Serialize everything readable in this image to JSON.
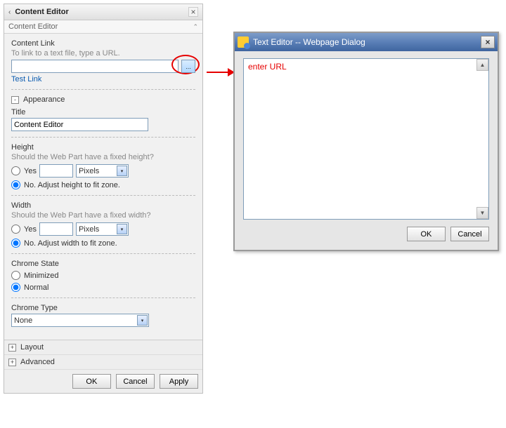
{
  "panel": {
    "header_title": "Content Editor",
    "sub_title": "Content Editor",
    "content_link": {
      "label": "Content Link",
      "hint": "To link to a text file, type a URL.",
      "value": "",
      "test_link_text": "Test Link"
    },
    "appearance": {
      "section_label": "Appearance",
      "title_label": "Title",
      "title_value": "Content Editor",
      "height_label": "Height",
      "height_hint": "Should the Web Part have a fixed height?",
      "height_yes": "Yes",
      "height_value": "",
      "height_unit": "Pixels",
      "height_no": "No. Adjust height to fit zone.",
      "width_label": "Width",
      "width_hint": "Should the Web Part have a fixed width?",
      "width_yes": "Yes",
      "width_value": "",
      "width_unit": "Pixels",
      "width_no": "No. Adjust width to fit zone.",
      "chrome_state_label": "Chrome State",
      "chrome_state_minimized": "Minimized",
      "chrome_state_normal": "Normal",
      "chrome_type_label": "Chrome Type",
      "chrome_type_value": "None"
    },
    "layout_label": "Layout",
    "advanced_label": "Advanced",
    "buttons": {
      "ok": "OK",
      "cancel": "Cancel",
      "apply": "Apply"
    }
  },
  "dialog": {
    "title": "Text Editor -- Webpage Dialog",
    "textarea_value": "enter URL",
    "buttons": {
      "ok": "OK",
      "cancel": "Cancel"
    }
  }
}
